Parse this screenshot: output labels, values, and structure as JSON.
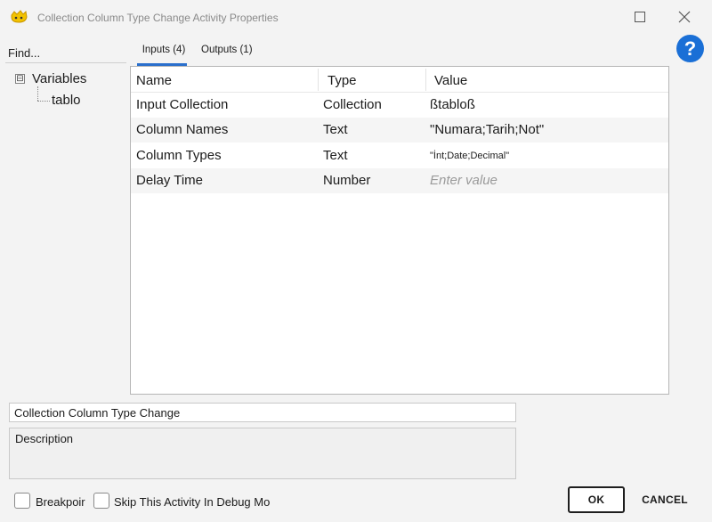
{
  "window": {
    "title": "Collection Column Type Change Activity Properties",
    "icon": "app-duck-icon",
    "maximize_icon": "maximize-icon",
    "close_icon": "close-icon"
  },
  "left_panel": {
    "find_label": "Find...",
    "tree": {
      "root_label": "Variables",
      "root_expander": "⊟",
      "children": [
        "tablo"
      ]
    }
  },
  "help": {
    "label": "?",
    "color": "#1a6fd6"
  },
  "tabs": [
    {
      "label": "Inputs (4)",
      "selected": true
    },
    {
      "label": "Outputs (1)",
      "selected": false
    }
  ],
  "grid": {
    "headers": {
      "name": "Name",
      "type": "Type",
      "value": "Value"
    },
    "rows": [
      {
        "name": "Input Collection",
        "type": "Collection",
        "value": "ßtabloß"
      },
      {
        "name": "Column Names",
        "type": "Text",
        "value": "\"Numara;Tarih;Not\""
      },
      {
        "name": "Column Types",
        "type": "Text",
        "value": "\"İnt;Date;Decimal\""
      },
      {
        "name": "Delay Time",
        "type": "Number",
        "value": "",
        "placeholder": "Enter value"
      }
    ]
  },
  "activity_name": "Collection Column Type Change",
  "description_placeholder": "Description",
  "options": {
    "breakpoint_label": "Breakpoir",
    "skip_label": "Skip This Activity In Debug Mo"
  },
  "buttons": {
    "ok": "OK",
    "cancel": "CANCEL"
  },
  "colors": {
    "accent": "#2a6fcc",
    "background": "#f3f3f3"
  }
}
